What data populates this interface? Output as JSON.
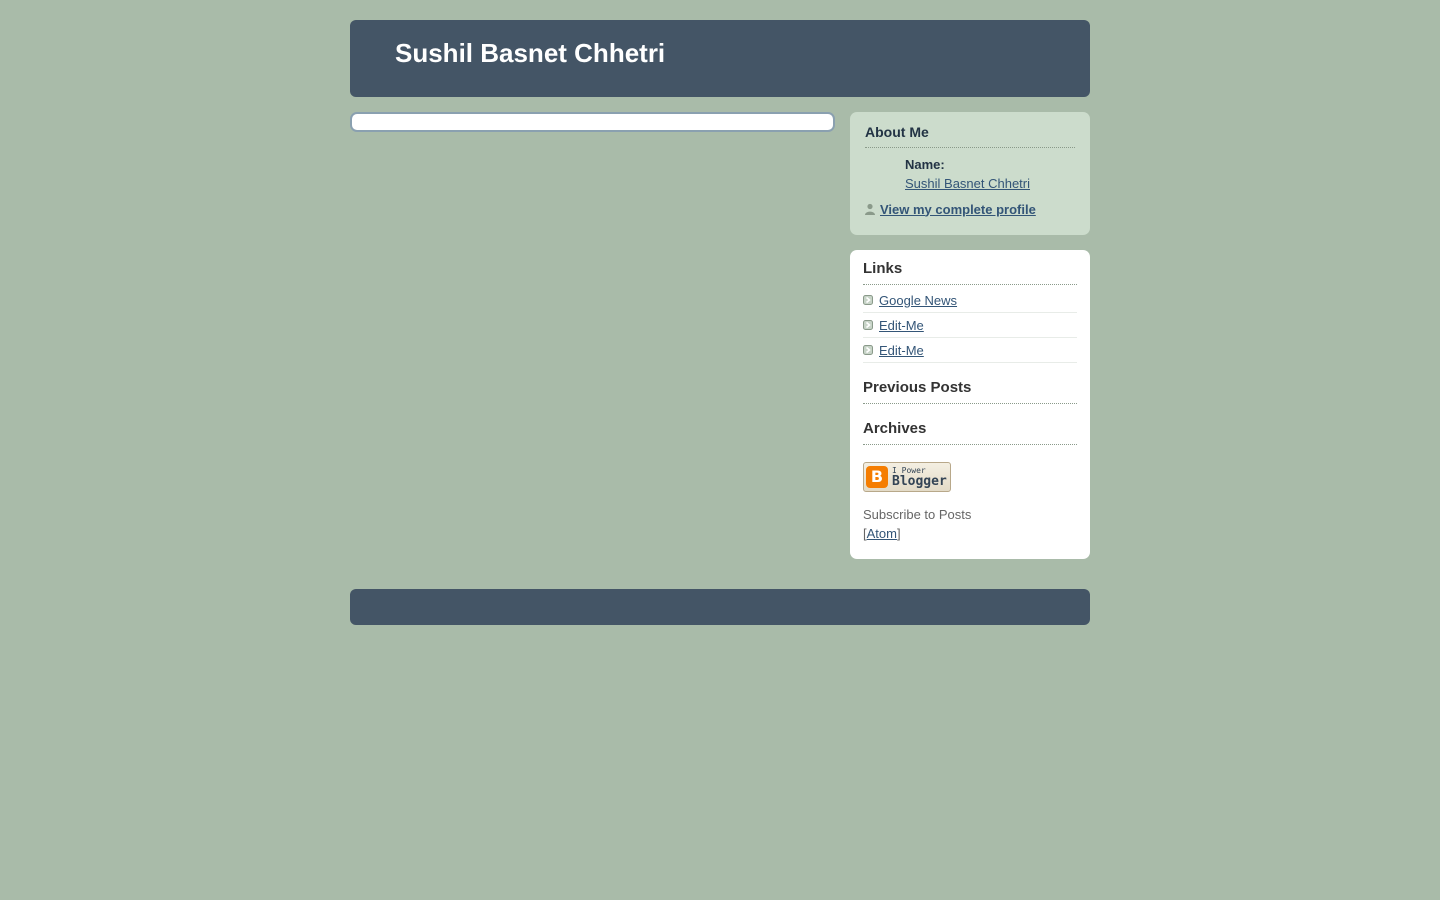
{
  "header": {
    "title": "Sushil Basnet Chhetri"
  },
  "about": {
    "heading": "About Me",
    "name_label": "Name:",
    "name_value": "Sushil Basnet Chhetri",
    "profile_link": "View my complete profile",
    "profile_icon": "person-icon"
  },
  "sidebar": {
    "links_heading": "Links",
    "links": [
      {
        "label": "Google News",
        "icon": "arrow-icon"
      },
      {
        "label": "Edit-Me",
        "icon": "arrow-icon"
      },
      {
        "label": "Edit-Me",
        "icon": "arrow-icon"
      }
    ],
    "previous_posts_heading": "Previous Posts",
    "archives_heading": "Archives",
    "badge": {
      "logo": "B",
      "line1": "I Power",
      "line2": "Blogger"
    },
    "subscribe_prefix": "Subscribe to Posts [",
    "subscribe_link": "Atom",
    "subscribe_suffix": "]"
  },
  "colors": {
    "page_background": "#a9bba9",
    "header_background": "#445566",
    "about_background": "#ccdccc",
    "link": "#335577",
    "blogger_orange": "#f57d00"
  }
}
